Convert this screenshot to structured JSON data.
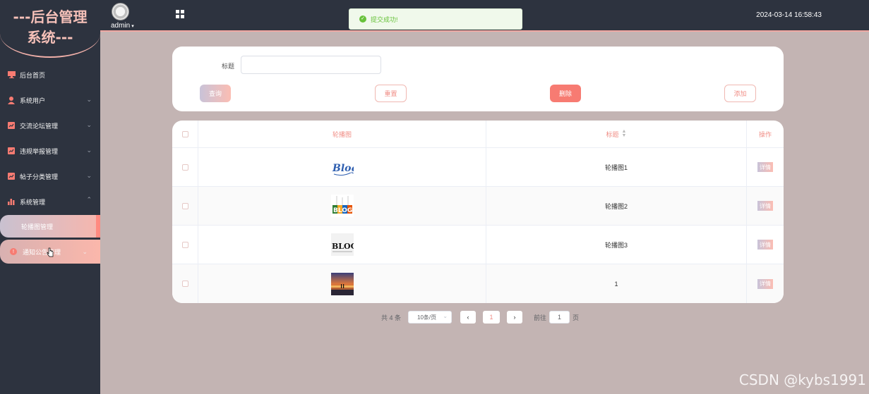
{
  "app": {
    "logo_line1": "---后台管理",
    "logo_line2": "系统---"
  },
  "header": {
    "user": "admin",
    "datetime": "2024-03-14 16:58:43"
  },
  "toast": {
    "message": "提交成功!"
  },
  "sidebar": {
    "items": [
      {
        "label": "后台首页",
        "icon": "monitor-icon"
      },
      {
        "label": "系统用户",
        "icon": "user-icon"
      },
      {
        "label": "交流论坛管理",
        "icon": "chart-icon"
      },
      {
        "label": "违规举报管理",
        "icon": "chart-icon"
      },
      {
        "label": "帖子分类管理",
        "icon": "chart-icon"
      },
      {
        "label": "系统管理",
        "icon": "bar-chart-icon"
      }
    ],
    "sub_active": "轮播图管理",
    "sub_next": "通知公告管理"
  },
  "search": {
    "label": "标题",
    "query": "查询",
    "reset": "重置",
    "delete": "删除",
    "add": "添加"
  },
  "table": {
    "headers": {
      "image": "轮播图",
      "title": "标题",
      "action": "操作"
    },
    "rows": [
      {
        "title": "轮播图1",
        "action": "详情",
        "image": "blog-blue"
      },
      {
        "title": "轮播图2",
        "action": "详情",
        "image": "blog-colorful"
      },
      {
        "title": "轮播图3",
        "action": "详情",
        "image": "blog-black"
      },
      {
        "title": "1",
        "action": "详情",
        "image": "sunset"
      }
    ]
  },
  "pagination": {
    "total": "共 4 条",
    "page_size": "10条/页",
    "current": "1",
    "goto_label": "前往",
    "goto_value": "1",
    "page_suffix": "页"
  },
  "watermark": "CSDN @kybs1991",
  "colors": {
    "accent": "#f08e86",
    "sidebar_bg": "#2d333f",
    "main_bg": "#c3b4b3",
    "success": "#67c23a"
  }
}
